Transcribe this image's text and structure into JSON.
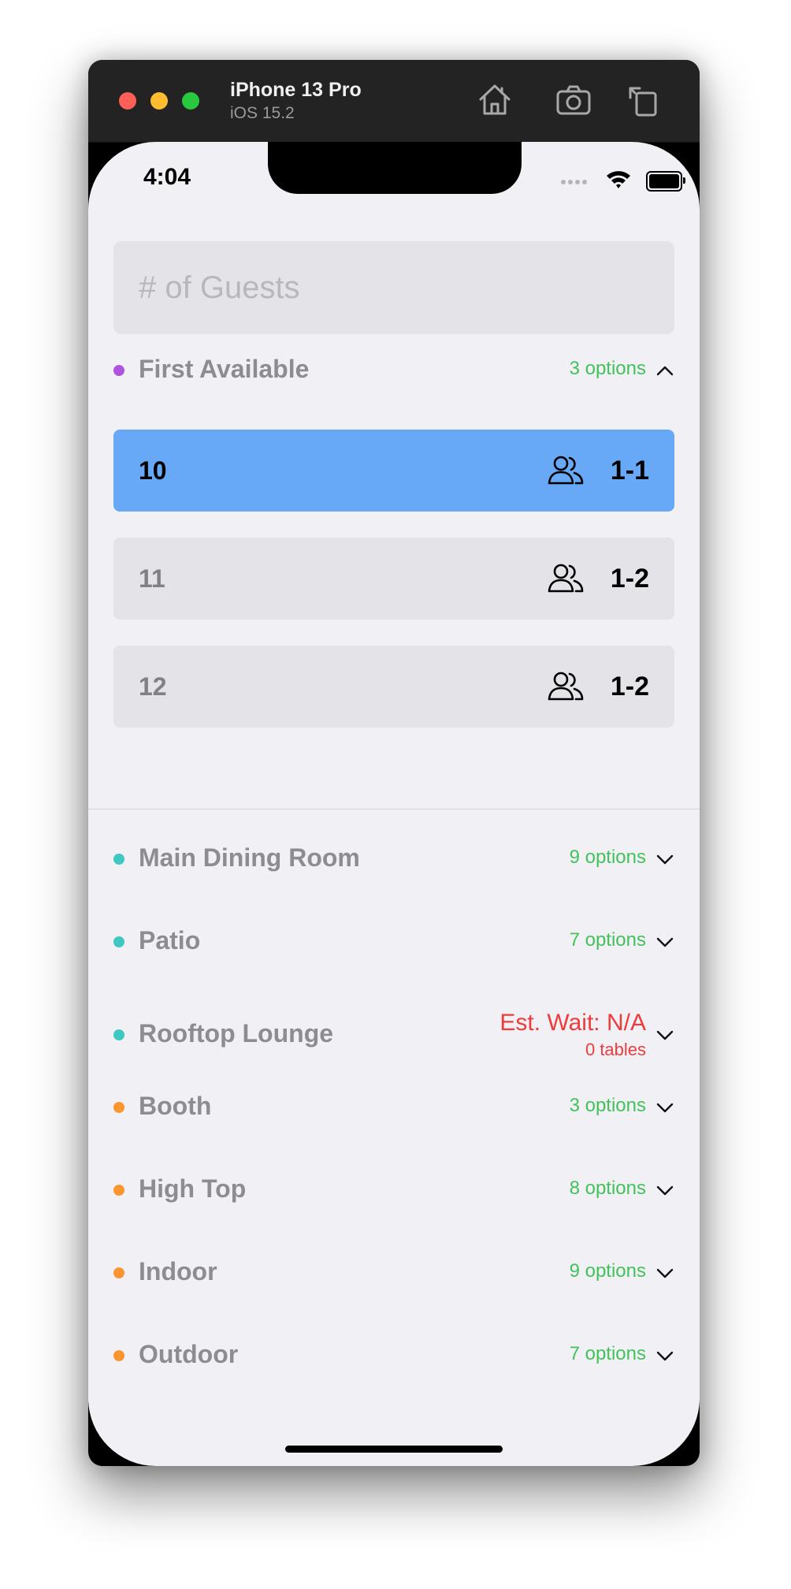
{
  "window": {
    "device_name": "iPhone 13 Pro",
    "os_version": "iOS 15.2",
    "toolbar_icons": [
      "home-icon",
      "camera-icon",
      "rotate-icon"
    ]
  },
  "status_bar": {
    "time": "4:04"
  },
  "guests_input": {
    "placeholder": "# of Guests",
    "value": ""
  },
  "sections": [
    {
      "name": "First Available",
      "color": "#af52de",
      "options": "3 options",
      "expanded": true
    },
    {
      "name": "Main Dining Room",
      "color": "#3ec8c1",
      "options": "9 options",
      "expanded": false
    },
    {
      "name": "Patio",
      "color": "#3ec8c1",
      "options": "7 options",
      "expanded": false
    },
    {
      "name": "Rooftop Lounge",
      "color": "#3ec8c1",
      "wait": "Est. Wait: N/A",
      "tables": "0 tables",
      "expanded": false
    },
    {
      "name": "Booth",
      "color": "#fb9530",
      "options": "3 options",
      "expanded": false
    },
    {
      "name": "High Top",
      "color": "#fb9530",
      "options": "8 options",
      "expanded": false
    },
    {
      "name": "Indoor",
      "color": "#fb9530",
      "options": "9 options",
      "expanded": false
    },
    {
      "name": "Outdoor",
      "color": "#fb9530",
      "options": "7 options",
      "expanded": false
    }
  ],
  "tables": [
    {
      "number": "10",
      "capacity": "1-1",
      "selected": true
    },
    {
      "number": "11",
      "capacity": "1-2",
      "selected": false
    },
    {
      "number": "12",
      "capacity": "1-2",
      "selected": false
    }
  ],
  "colors": {
    "selected_row": "#67a9f7",
    "options_text": "#43c25c",
    "wait_text": "#ee3b3b"
  }
}
